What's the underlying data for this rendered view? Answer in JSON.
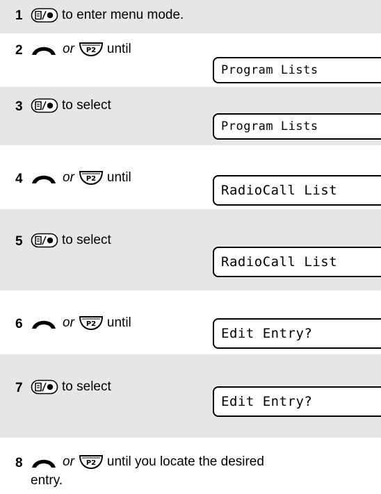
{
  "steps": [
    {
      "num": "1",
      "text": "to enter menu mode."
    },
    {
      "num": "2",
      "or": "or",
      "text": "until",
      "display": "Program Lists"
    },
    {
      "num": "3",
      "text": "to select",
      "display": "Program Lists"
    },
    {
      "num": "4",
      "or": "or",
      "text": "until",
      "display": "RadioCall List"
    },
    {
      "num": "5",
      "text": "to select",
      "display": "RadioCall List"
    },
    {
      "num": "6",
      "or": "or",
      "text": "until",
      "display": "Edit Entry?"
    },
    {
      "num": "7",
      "text": "to select",
      "display": "Edit Entry?"
    },
    {
      "num": "8",
      "or": "or",
      "text": "until you locate the desired",
      "text2": "entry."
    }
  ],
  "icons": {
    "menu": "menu-select-button-icon",
    "up": "up-arrow-button-icon",
    "p2": "p2-down-button-icon"
  },
  "colors": {
    "shade": "#e6e6e6"
  }
}
